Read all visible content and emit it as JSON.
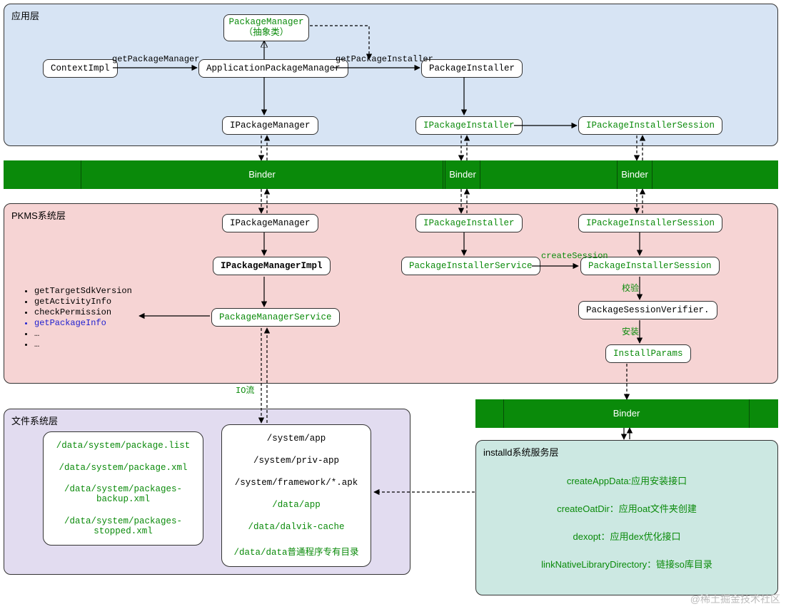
{
  "layers": {
    "app": {
      "title": "应用层"
    },
    "pkms": {
      "title": "PKMS系统层"
    },
    "fs": {
      "title": "文件系统层"
    },
    "installd": {
      "title": "installd系统服务层"
    }
  },
  "nodes": {
    "contextImpl": "ContextImpl",
    "packageManagerAbstract_l1": "PackageManager",
    "packageManagerAbstract_l2": "（抽象类）",
    "appPackageManager": "ApplicationPackageManager",
    "packageInstaller": "PackageInstaller",
    "iPackageManager_app": "IPackageManager",
    "iPackageInstaller_app": "IPackageInstaller",
    "iPackageInstallerSession_app": "IPackageInstallerSession",
    "iPackageManager_pkms": "IPackageManager",
    "iPackageInstaller_pkms": "IPackageInstaller",
    "iPackageInstallerSession_pkms": "IPackageInstallerSession",
    "iPackageManagerImpl": "IPackageManagerImpl",
    "packageInstallerService": "PackageInstallerService",
    "packageInstallerSession": "PackageInstallerSession",
    "packageManagerService": "PackageManagerService",
    "packageSessionVerifier": "PackageSessionVerifier.",
    "installParams": "InstallParams"
  },
  "binder_label": "Binder",
  "edges": {
    "getPackageManager": "getPackageManager",
    "getPackageInstaller": "getPackageInstaller",
    "createSession": "createSession",
    "verify": "校验",
    "install": "安装",
    "ioStream": "IO流"
  },
  "methods": [
    "getTargetSdkVersion",
    "getActivityInfo",
    "checkPermission",
    "getPackageInfo",
    "…",
    "…"
  ],
  "methods_special_index": 3,
  "filesystem": {
    "left": [
      "/data/system/package.list",
      "/data/system/package.xml",
      "/data/system/packages-backup.xml",
      "/data/system/packages-stopped.xml"
    ],
    "right": [
      "/system/app",
      "/system/priv-app",
      "/system/framework/*.apk",
      "/data/app",
      "/data/dalvik-cache",
      "/data/data普通程序专有目录"
    ]
  },
  "installd_items": [
    "createAppData:应用安装接口",
    "createOatDir：应用oat文件夹创建",
    "dexopt：应用dex优化接口",
    "linkNativeLibraryDirectory：链接so库目录"
  ],
  "watermark": "@稀土掘金技术社区"
}
